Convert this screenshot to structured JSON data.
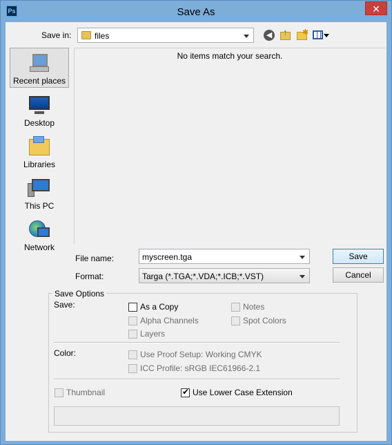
{
  "window": {
    "title": "Save As",
    "app_icon_text": "Ps",
    "close_glyph": "✕"
  },
  "toolbar": {
    "save_in_label": "Save in:",
    "current_folder": "files",
    "back_icon": "back-arrow-icon",
    "up_icon": "up-folder-icon",
    "new_folder_icon": "new-folder-icon",
    "views_icon": "views-menu-icon"
  },
  "places": [
    {
      "label": "Recent places",
      "icon": "recent-places-icon",
      "selected": true
    },
    {
      "label": "Desktop",
      "icon": "desktop-icon",
      "selected": false
    },
    {
      "label": "Libraries",
      "icon": "libraries-icon",
      "selected": false
    },
    {
      "label": "This PC",
      "icon": "this-pc-icon",
      "selected": false
    },
    {
      "label": "Network",
      "icon": "network-icon",
      "selected": false
    }
  ],
  "file_list": {
    "empty_message": "No items match your search."
  },
  "form": {
    "file_name_label": "File name:",
    "file_name_value": "myscreen.tga",
    "format_label": "Format:",
    "format_value": "Targa (*.TGA;*.VDA;*.ICB;*.VST)",
    "save_button": "Save",
    "cancel_button": "Cancel"
  },
  "save_options": {
    "legend": "Save Options",
    "save_label": "Save:",
    "as_a_copy": {
      "label": "As a Copy",
      "checked": false,
      "enabled": true
    },
    "notes": {
      "label": "Notes",
      "checked": false,
      "enabled": false
    },
    "alpha_channels": {
      "label": "Alpha Channels",
      "checked": false,
      "enabled": false
    },
    "spot_colors": {
      "label": "Spot Colors",
      "checked": false,
      "enabled": false
    },
    "layers": {
      "label": "Layers",
      "checked": false,
      "enabled": false
    },
    "color_label": "Color:",
    "use_proof_setup": {
      "label": "Use Proof Setup:  Working CMYK",
      "checked": false,
      "enabled": false
    },
    "icc_profile": {
      "label": "ICC Profile:  sRGB IEC61966-2.1",
      "checked": false,
      "enabled": false
    },
    "thumbnail": {
      "label": "Thumbnail",
      "checked": false,
      "enabled": false
    },
    "lower_case_ext": {
      "label": "Use Lower Case Extension",
      "checked": true,
      "enabled": true
    }
  },
  "colors": {
    "title_bar": "#7dadd9",
    "client_bg": "#f0f0f0",
    "close_button": "#c7413a"
  }
}
